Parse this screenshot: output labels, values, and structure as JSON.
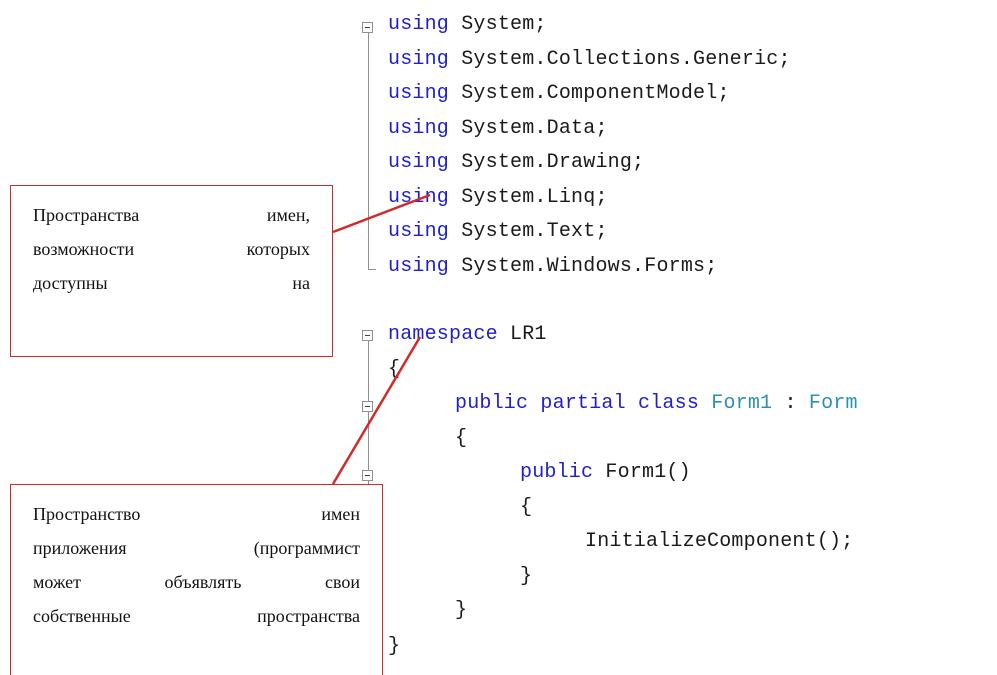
{
  "code": {
    "using_keyword": "using",
    "usings": [
      "System;",
      "System.Collections.Generic;",
      "System.ComponentModel;",
      "System.Data;",
      "System.Drawing;",
      "System.Linq;",
      "System.Text;",
      "System.Windows.Forms;"
    ],
    "namespace_keyword": "namespace",
    "namespace_name": "LR1",
    "open_brace": "{",
    "close_brace": "}",
    "class_modifiers": "public partial class",
    "class_name": "Form1",
    "colon": ":",
    "base_class": "Form",
    "ctor_modifier": "public",
    "ctor_signature": "Form1()",
    "ctor_call": "InitializeComponent();"
  },
  "callouts": {
    "namespaces_available": [
      [
        "Пространства",
        "имен,"
      ],
      [
        "возможности",
        "которых"
      ],
      [
        "доступны",
        "на"
      ]
    ],
    "app_namespace": [
      [
        "Пространство",
        "имен"
      ],
      [
        "приложения",
        "(программист"
      ],
      [
        "может",
        "объявлять",
        "свои"
      ],
      [
        "собственные",
        "пространства"
      ]
    ]
  },
  "colors": {
    "keyword": "#1f1fcc",
    "type": "#2b91af",
    "callout_border": "#d22a2a"
  }
}
